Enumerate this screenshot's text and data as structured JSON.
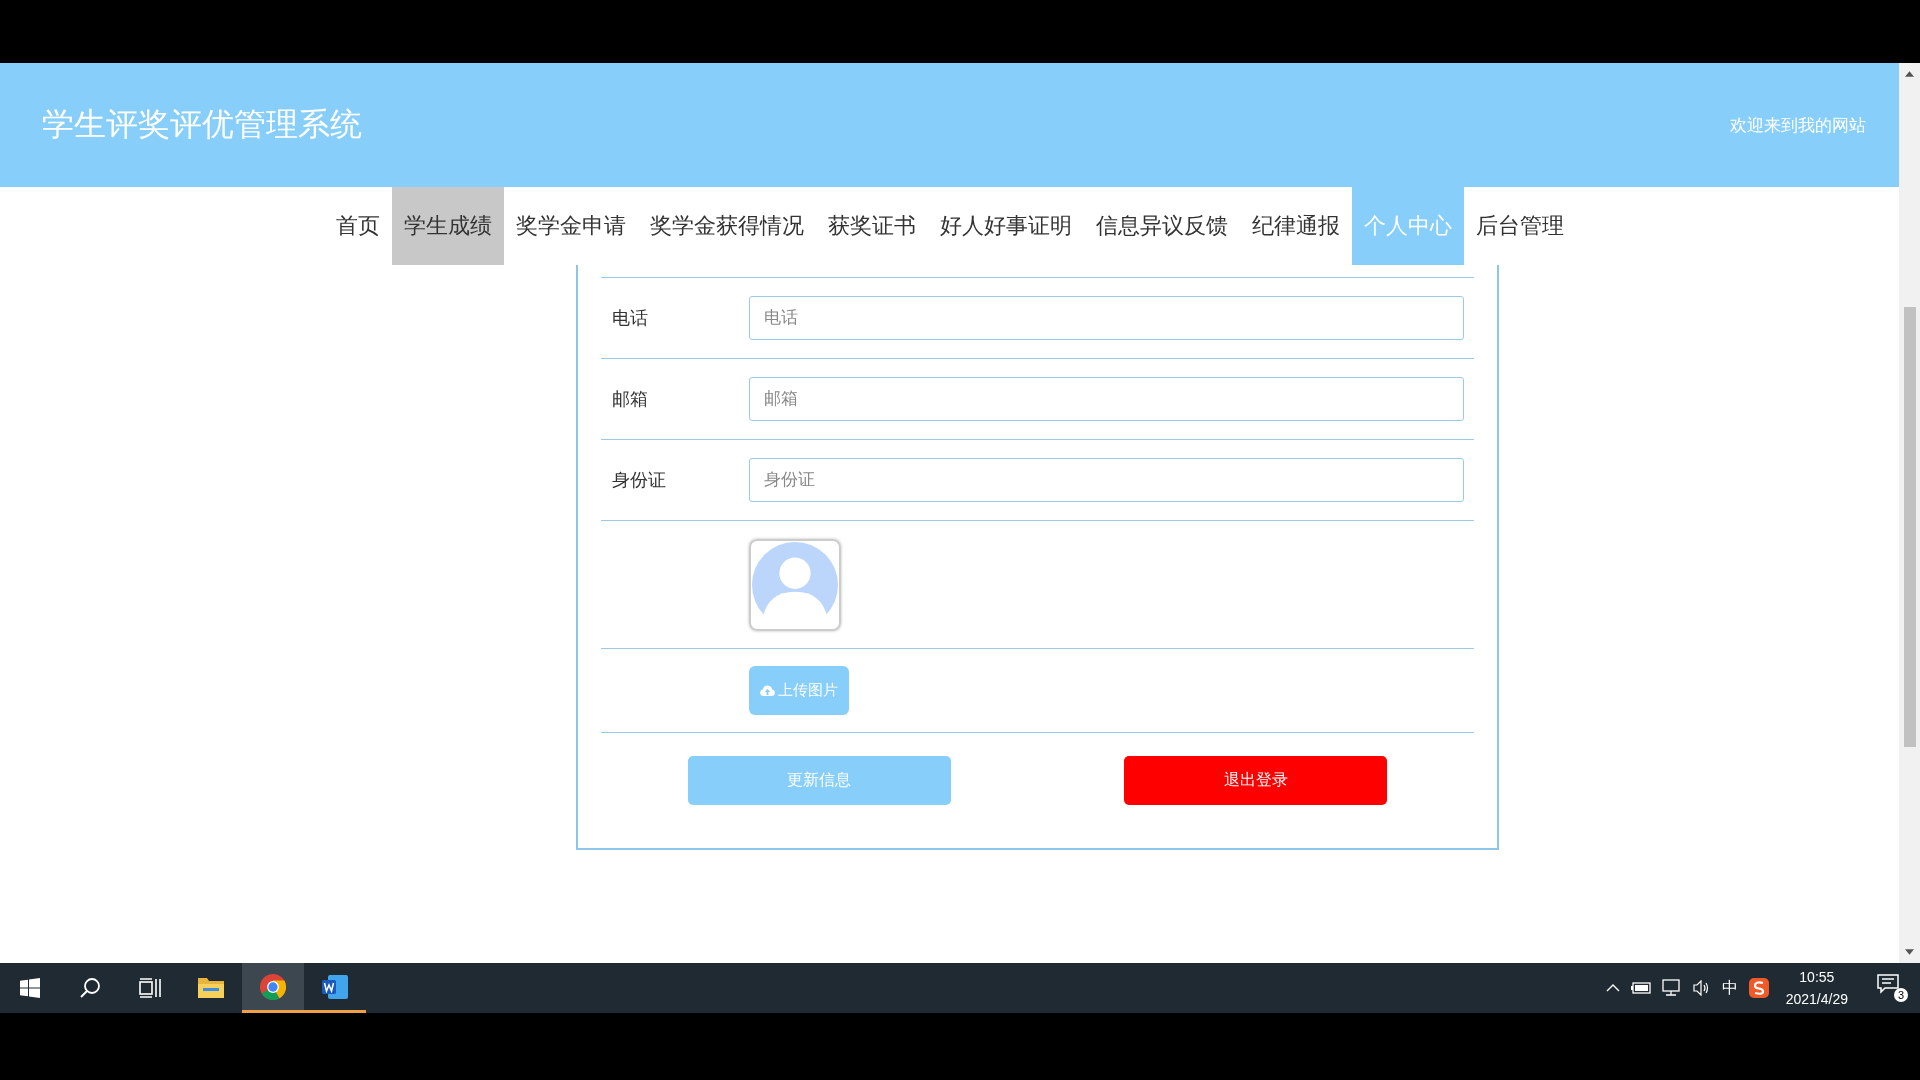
{
  "header": {
    "title": "学生评奖评优管理系统",
    "welcome": "欢迎来到我的网站"
  },
  "nav": [
    {
      "label": "首页",
      "selected": false,
      "hovered": false
    },
    {
      "label": "学生成绩",
      "selected": false,
      "hovered": true
    },
    {
      "label": "奖学金申请",
      "selected": false,
      "hovered": false
    },
    {
      "label": "奖学金获得情况",
      "selected": false,
      "hovered": false
    },
    {
      "label": "获奖证书",
      "selected": false,
      "hovered": false
    },
    {
      "label": "好人好事证明",
      "selected": false,
      "hovered": false
    },
    {
      "label": "信息异议反馈",
      "selected": false,
      "hovered": false
    },
    {
      "label": "纪律通报",
      "selected": false,
      "hovered": false
    },
    {
      "label": "个人中心",
      "selected": true,
      "hovered": false
    },
    {
      "label": "后台管理",
      "selected": false,
      "hovered": false
    }
  ],
  "form": {
    "fields": [
      {
        "label": "电话",
        "placeholder": "电话"
      },
      {
        "label": "邮箱",
        "placeholder": "邮箱"
      },
      {
        "label": "身份证",
        "placeholder": "身份证"
      }
    ],
    "upload_button": "上传图片",
    "buttons": [
      {
        "label": "更新信息",
        "kind": "primary"
      },
      {
        "label": "退出登录",
        "kind": "danger"
      }
    ]
  },
  "taskbar": {
    "apps": [
      {
        "kind": "explorer",
        "running": false,
        "active": false
      },
      {
        "kind": "browser",
        "running": true,
        "active": true
      },
      {
        "kind": "word",
        "running": true,
        "active": false
      }
    ],
    "ime": "中",
    "time": "10:55",
    "date": "2021/4/29",
    "notifications": "3"
  }
}
